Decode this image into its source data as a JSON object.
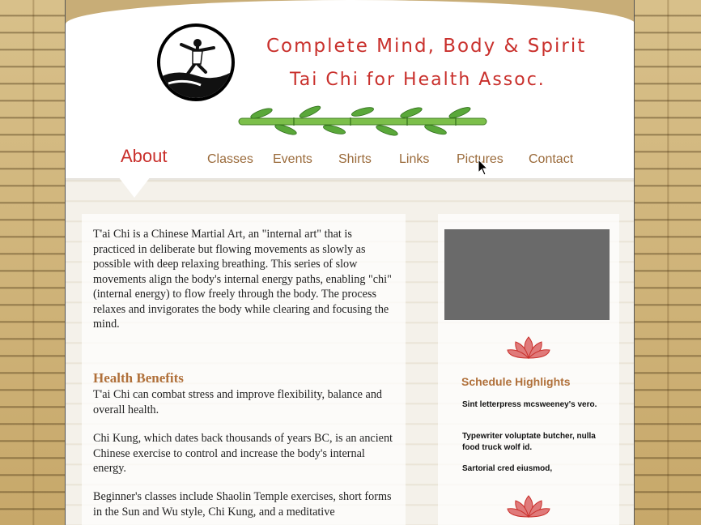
{
  "header": {
    "title_line1": "Complete Mind, Body & Spirit",
    "title_line2": "Tai Chi for Health Assoc.",
    "logo_icon": "tai-chi-figure-logo-icon",
    "decoration_icon": "bamboo-branch-icon"
  },
  "nav": {
    "items": [
      {
        "label": "About",
        "active": true
      },
      {
        "label": "Classes"
      },
      {
        "label": "Events"
      },
      {
        "label": "Shirts"
      },
      {
        "label": "Links"
      },
      {
        "label": "Pictures"
      },
      {
        "label": "Contact"
      }
    ]
  },
  "main": {
    "intro": "T'ai Chi is a Chinese Martial Art, an \"internal art\" that is practiced in deliberate but flowing movements as slowly as possible with deep relaxing breathing. This series of slow movements align the body's internal energy paths, enabling \"chi\" (internal energy) to flow freely through the body. The process relaxes and invigorates the body while clearing and focusing the mind.",
    "health_heading": "Health Benefits",
    "health_p1": "T'ai Chi can combat stress and improve flexibility, balance and overall health.",
    "health_p2": "Chi Kung, which dates back thousands of years BC, is an ancient Chinese exercise to control and increase the body's internal energy.",
    "health_p3": "Beginner's classes include Shaolin Temple exercises, short forms in the Sun and Wu style, Chi Kung, and a meditative"
  },
  "sidebar": {
    "video_placeholder": "",
    "lotus_icon": "lotus-flower-icon",
    "schedule_title": "Schedule Highlights",
    "schedule_items": [
      "Sint letterpress mcsweeney's vero.",
      "Typewriter voluptate butcher, nulla food truck wolf id.",
      "Sartorial cred eiusmod,"
    ]
  },
  "colors": {
    "accent_red": "#c9302c",
    "nav_brown": "#9a6a3a",
    "heading_brown": "#b0703a"
  }
}
